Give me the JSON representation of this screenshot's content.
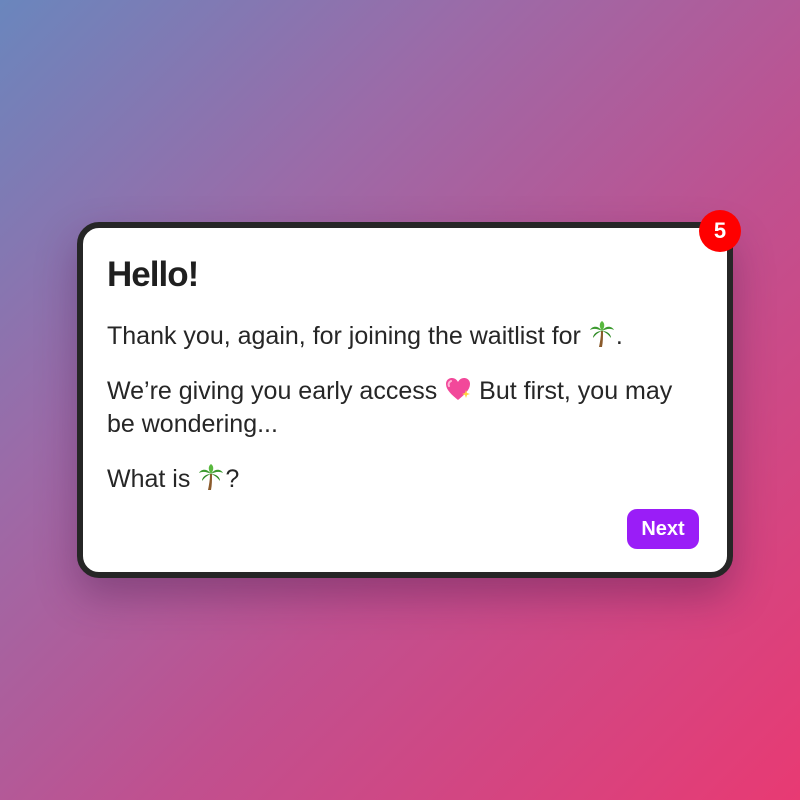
{
  "card": {
    "badge_count": "5",
    "title": "Hello!",
    "line1_before": "Thank you, again, for joining the waitlist for",
    "line1_after": ".",
    "line2_before": "We’re giving you early access",
    "line2_after": "But first, you may be wondering...",
    "line3_before": "What is",
    "line3_after": "?",
    "icons": {
      "palm": "palm-tree-icon",
      "heart": "sparkling-heart-icon"
    },
    "next_label": "Next"
  },
  "colors": {
    "badge": "#ff0000",
    "button": "#9a1df7",
    "card_border": "#262626",
    "background_start": "#6a86bd",
    "background_end": "#e83a73"
  }
}
